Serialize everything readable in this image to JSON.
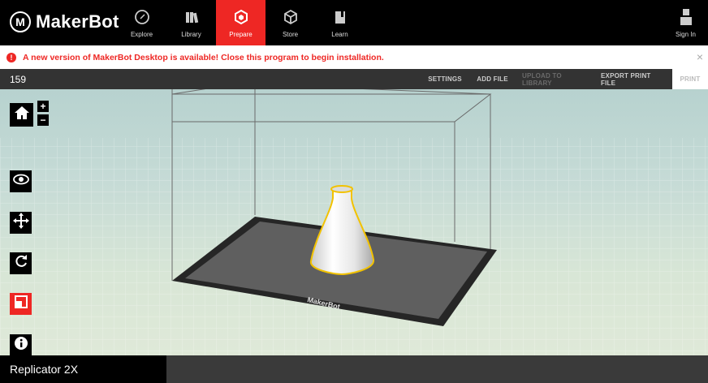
{
  "app": {
    "logo_text": "MakerBot",
    "logo_mark": "M"
  },
  "nav": [
    {
      "label": "Explore",
      "icon": "compass-icon"
    },
    {
      "label": "Library",
      "icon": "library-icon"
    },
    {
      "label": "Prepare",
      "icon": "prepare-cube-icon",
      "active": true
    },
    {
      "label": "Store",
      "icon": "store-cube-icon"
    },
    {
      "label": "Learn",
      "icon": "learn-book-icon"
    }
  ],
  "signin": {
    "label": "Sign In",
    "icon": "user-icon"
  },
  "alert": {
    "text": "A new version of MakerBot Desktop is available! Close this program to begin installation.",
    "icon": "alert-icon",
    "close": "×"
  },
  "toolbar": {
    "title": "159",
    "settings": "SETTINGS",
    "add_file": "ADD FILE",
    "upload": "UPLOAD TO LIBRARY",
    "export": "EXPORT PRINT FILE",
    "print": "PRINT"
  },
  "viewport": {
    "plate_logo": "MakerBot",
    "zoom_in": "+",
    "zoom_out": "−",
    "tools": [
      "home-icon",
      "eye-icon",
      "move-icon",
      "rotate-icon",
      "scale-icon",
      "info-icon"
    ]
  },
  "status": {
    "printer": "Replicator 2X"
  },
  "colors": {
    "accent": "#ee2724",
    "selection": "#f2c200",
    "plate": "#5f5f5f",
    "plate_border": "#262626"
  }
}
